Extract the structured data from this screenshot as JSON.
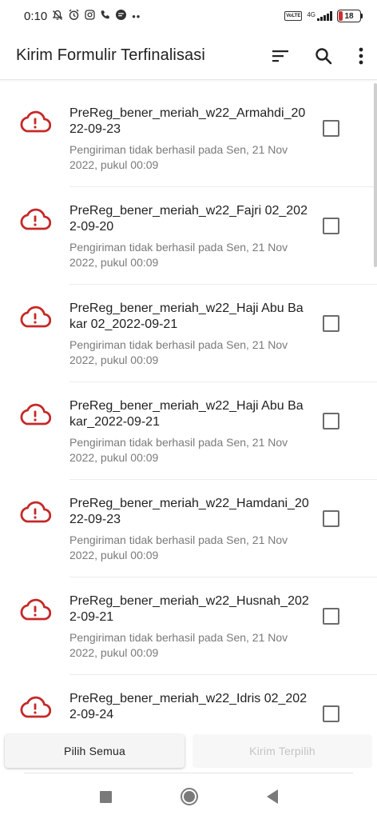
{
  "status_bar": {
    "time": "0:10",
    "icons": [
      "bell-off-icon",
      "alarm-icon",
      "instagram-icon",
      "phone-icon",
      "message-icon",
      "more-dots-icon"
    ],
    "volte": "VoLTE",
    "network": "4G",
    "battery": "18",
    "battery_level": 0.18,
    "battery_color": "#d32f2f"
  },
  "app_bar": {
    "title": "Kirim Formulir Terfinalisasi",
    "actions": [
      "sort-icon",
      "search-icon",
      "more-vert-icon"
    ]
  },
  "colors": {
    "error_icon": "#c62828",
    "secondary_text": "#7a7a7a"
  },
  "forms": [
    {
      "name": "PreReg_bener_meriah_w22_Armahdi_2022-09-23",
      "status": "Pengiriman tidak berhasil pada Sen, 21 Nov 2022, pukul 00:09",
      "checked": false
    },
    {
      "name": "PreReg_bener_meriah_w22_Fajri 02_2022-09-20",
      "status": "Pengiriman tidak berhasil pada Sen, 21 Nov 2022, pukul 00:09",
      "checked": false
    },
    {
      "name": "PreReg_bener_meriah_w22_Haji Abu Bakar 02_2022-09-21",
      "status": "Pengiriman tidak berhasil pada Sen, 21 Nov 2022, pukul 00:09",
      "checked": false
    },
    {
      "name": "PreReg_bener_meriah_w22_Haji Abu Bakar_2022-09-21",
      "status": "Pengiriman tidak berhasil pada Sen, 21 Nov 2022, pukul 00:09",
      "checked": false
    },
    {
      "name": "PreReg_bener_meriah_w22_Hamdani_2022-09-23",
      "status": "Pengiriman tidak berhasil pada Sen, 21 Nov 2022, pukul 00:09",
      "checked": false
    },
    {
      "name": "PreReg_bener_meriah_w22_Husnah_2022-09-21",
      "status": "Pengiriman tidak berhasil pada Sen, 21 Nov 2022, pukul 00:09",
      "checked": false
    },
    {
      "name": "PreReg_bener_meriah_w22_Idris 02_2022-09-24",
      "status": "",
      "checked": false
    }
  ],
  "buttons": {
    "select_all": "Pilih Semua",
    "send_selected": "Kirim Terpilih"
  },
  "nav": [
    "recents-icon",
    "home-icon",
    "back-icon"
  ]
}
